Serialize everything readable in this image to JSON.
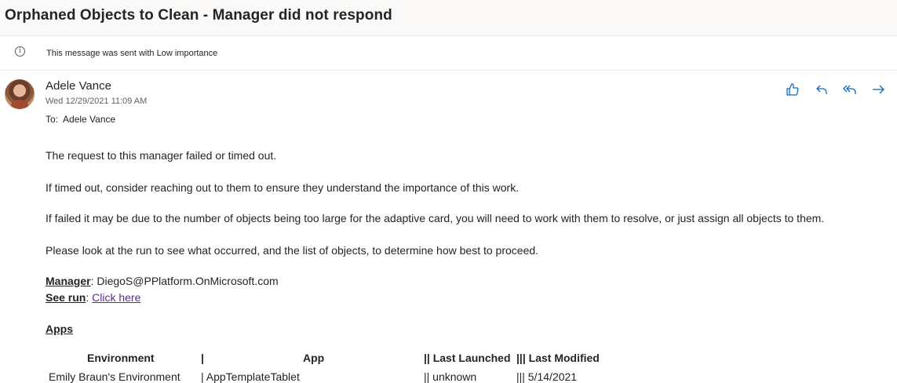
{
  "subject": "Orphaned Objects to Clean - Manager did not respond",
  "importance": {
    "text": "This message was sent with Low importance",
    "icon": "info-icon"
  },
  "message": {
    "sender": "Adele Vance",
    "date": "Wed 12/29/2021 11:09 AM",
    "to_label": "To:",
    "to_value": "Adele Vance"
  },
  "actions": [
    {
      "name": "like",
      "icon": "thumbs-up-icon"
    },
    {
      "name": "reply",
      "icon": "reply-icon"
    },
    {
      "name": "reply-all",
      "icon": "reply-all-icon"
    },
    {
      "name": "forward",
      "icon": "forward-icon"
    }
  ],
  "body": {
    "p1": "The request to this manager failed or timed out.",
    "p2": "If timed out, consider reaching out to them to ensure they understand the importance of this work.",
    "p3": "If failed it may be due to the number of objects being too large for the adaptive card, you will need to work with them to resolve, or just assign all objects to them.",
    "p4": "Please look at the run to see what occurred, and the list of objects, to determine how best to proceed.",
    "manager_label": "Manager",
    "manager_value": ": DiegoS@PPlatform.OnMicrosoft.com",
    "run_label": "See run",
    "run_sep": ": ",
    "run_link": "Click here",
    "apps_heading": "Apps",
    "table": {
      "headers": [
        "Environment",
        "|",
        "App",
        "|| Last Launched",
        "||| Last Modified"
      ],
      "row": [
        "Emily Braun's Environment",
        "| AppTemplateTablet",
        "||  unknown",
        "|||  5/14/2021"
      ]
    }
  },
  "colors": {
    "accent": "#0f6cbd",
    "link": "#5c2d91"
  }
}
